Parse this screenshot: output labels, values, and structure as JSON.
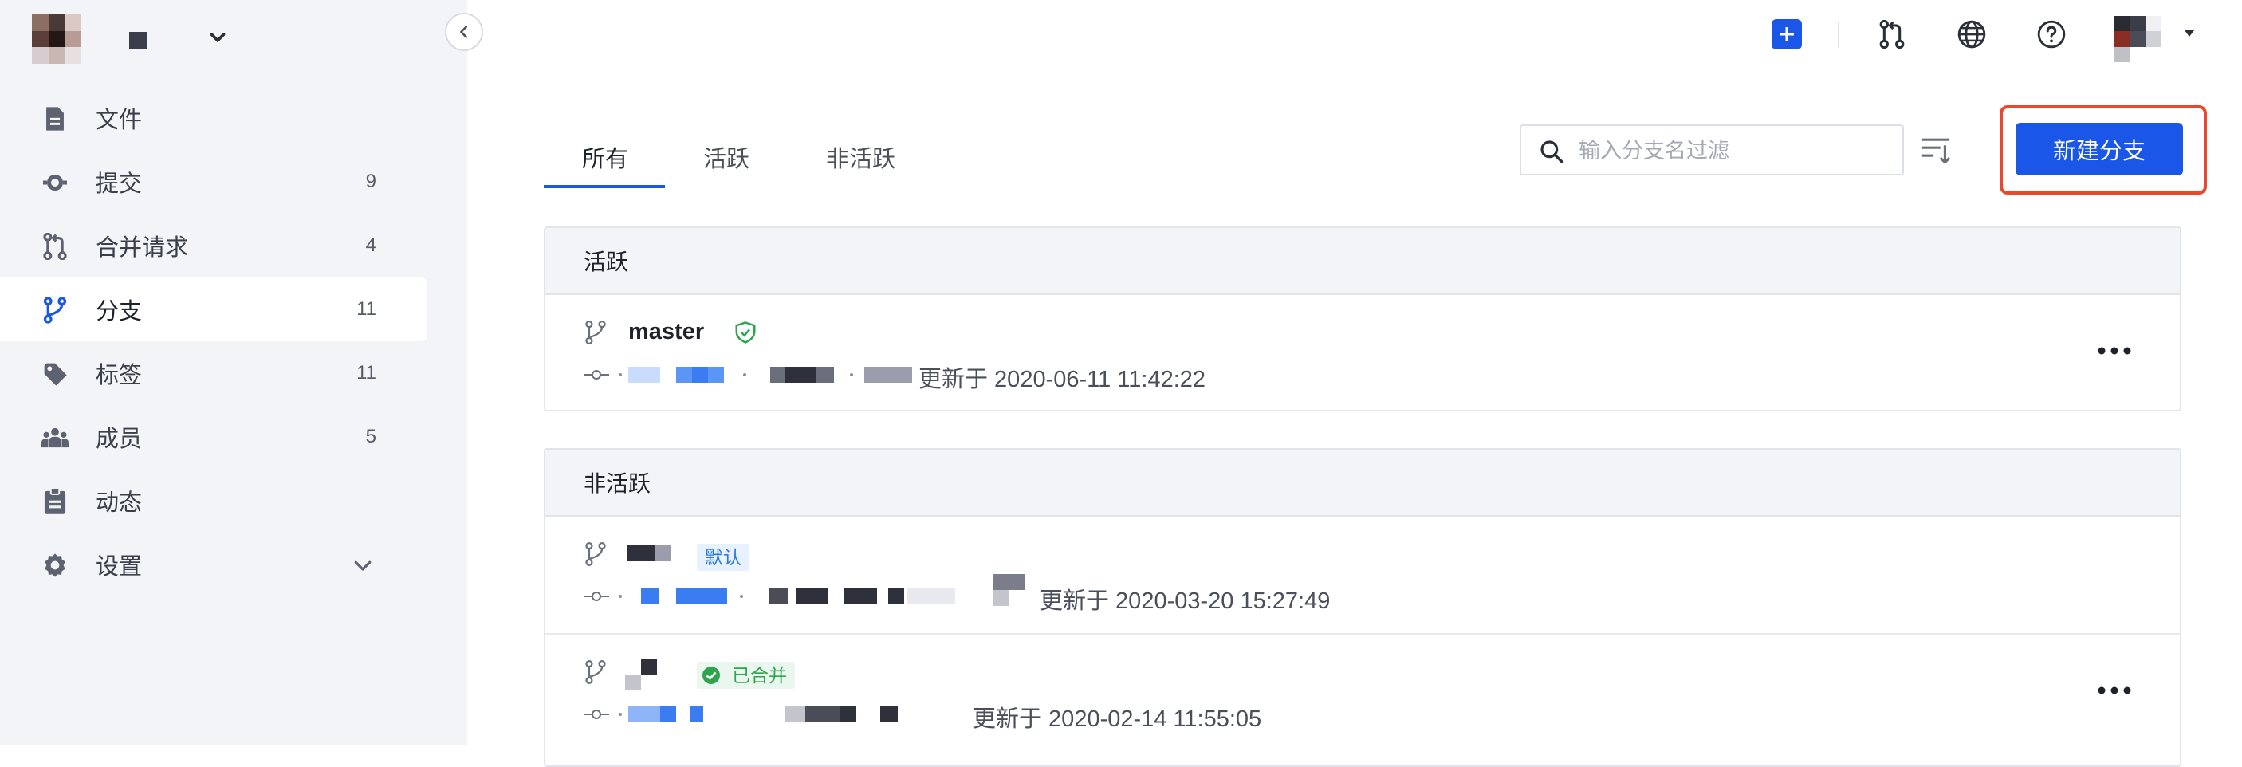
{
  "sidebar": {
    "items": [
      {
        "key": "files",
        "label": "文件",
        "count": "",
        "icon": "file-icon"
      },
      {
        "key": "commits",
        "label": "提交",
        "count": "9",
        "icon": "commit-icon"
      },
      {
        "key": "merge-requests",
        "label": "合并请求",
        "count": "4",
        "icon": "merge-request-icon"
      },
      {
        "key": "branches",
        "label": "分支",
        "count": "11",
        "icon": "branch-icon",
        "active": true
      },
      {
        "key": "tags",
        "label": "标签",
        "count": "11",
        "icon": "tag-icon"
      },
      {
        "key": "members",
        "label": "成员",
        "count": "5",
        "icon": "members-icon"
      },
      {
        "key": "activity",
        "label": "动态",
        "count": "",
        "icon": "clipboard-icon"
      },
      {
        "key": "settings",
        "label": "设置",
        "count": "",
        "icon": "gear-icon"
      }
    ]
  },
  "topbar": {
    "icons": [
      "plus-icon",
      "merge-request-icon",
      "globe-icon",
      "help-icon"
    ]
  },
  "tabs": [
    {
      "label": "所有",
      "active": true
    },
    {
      "label": "活跃"
    },
    {
      "label": "非活跃"
    }
  ],
  "search": {
    "placeholder": "输入分支名过滤",
    "value": ""
  },
  "actions": {
    "new_branch": "新建分支"
  },
  "sections": {
    "active": {
      "title": "活跃",
      "branches": [
        {
          "name": "master",
          "protected": true,
          "updated": "更新于 2020-06-11 11:42:22"
        }
      ]
    },
    "inactive": {
      "title": "非活跃",
      "branches": [
        {
          "name": "",
          "badge": "默认",
          "updated": "更新于 2020-03-20 15:27:49"
        },
        {
          "name": "",
          "badge": "已合并",
          "updated": "更新于 2020-02-14 11:55:05"
        }
      ]
    }
  },
  "colors": {
    "accent": "#1a56e8",
    "highlight_border": "#e8492c",
    "protected_green": "#2ea44f",
    "default_badge": "#2c7be5",
    "sidebar_bg": "#f3f4f7"
  }
}
